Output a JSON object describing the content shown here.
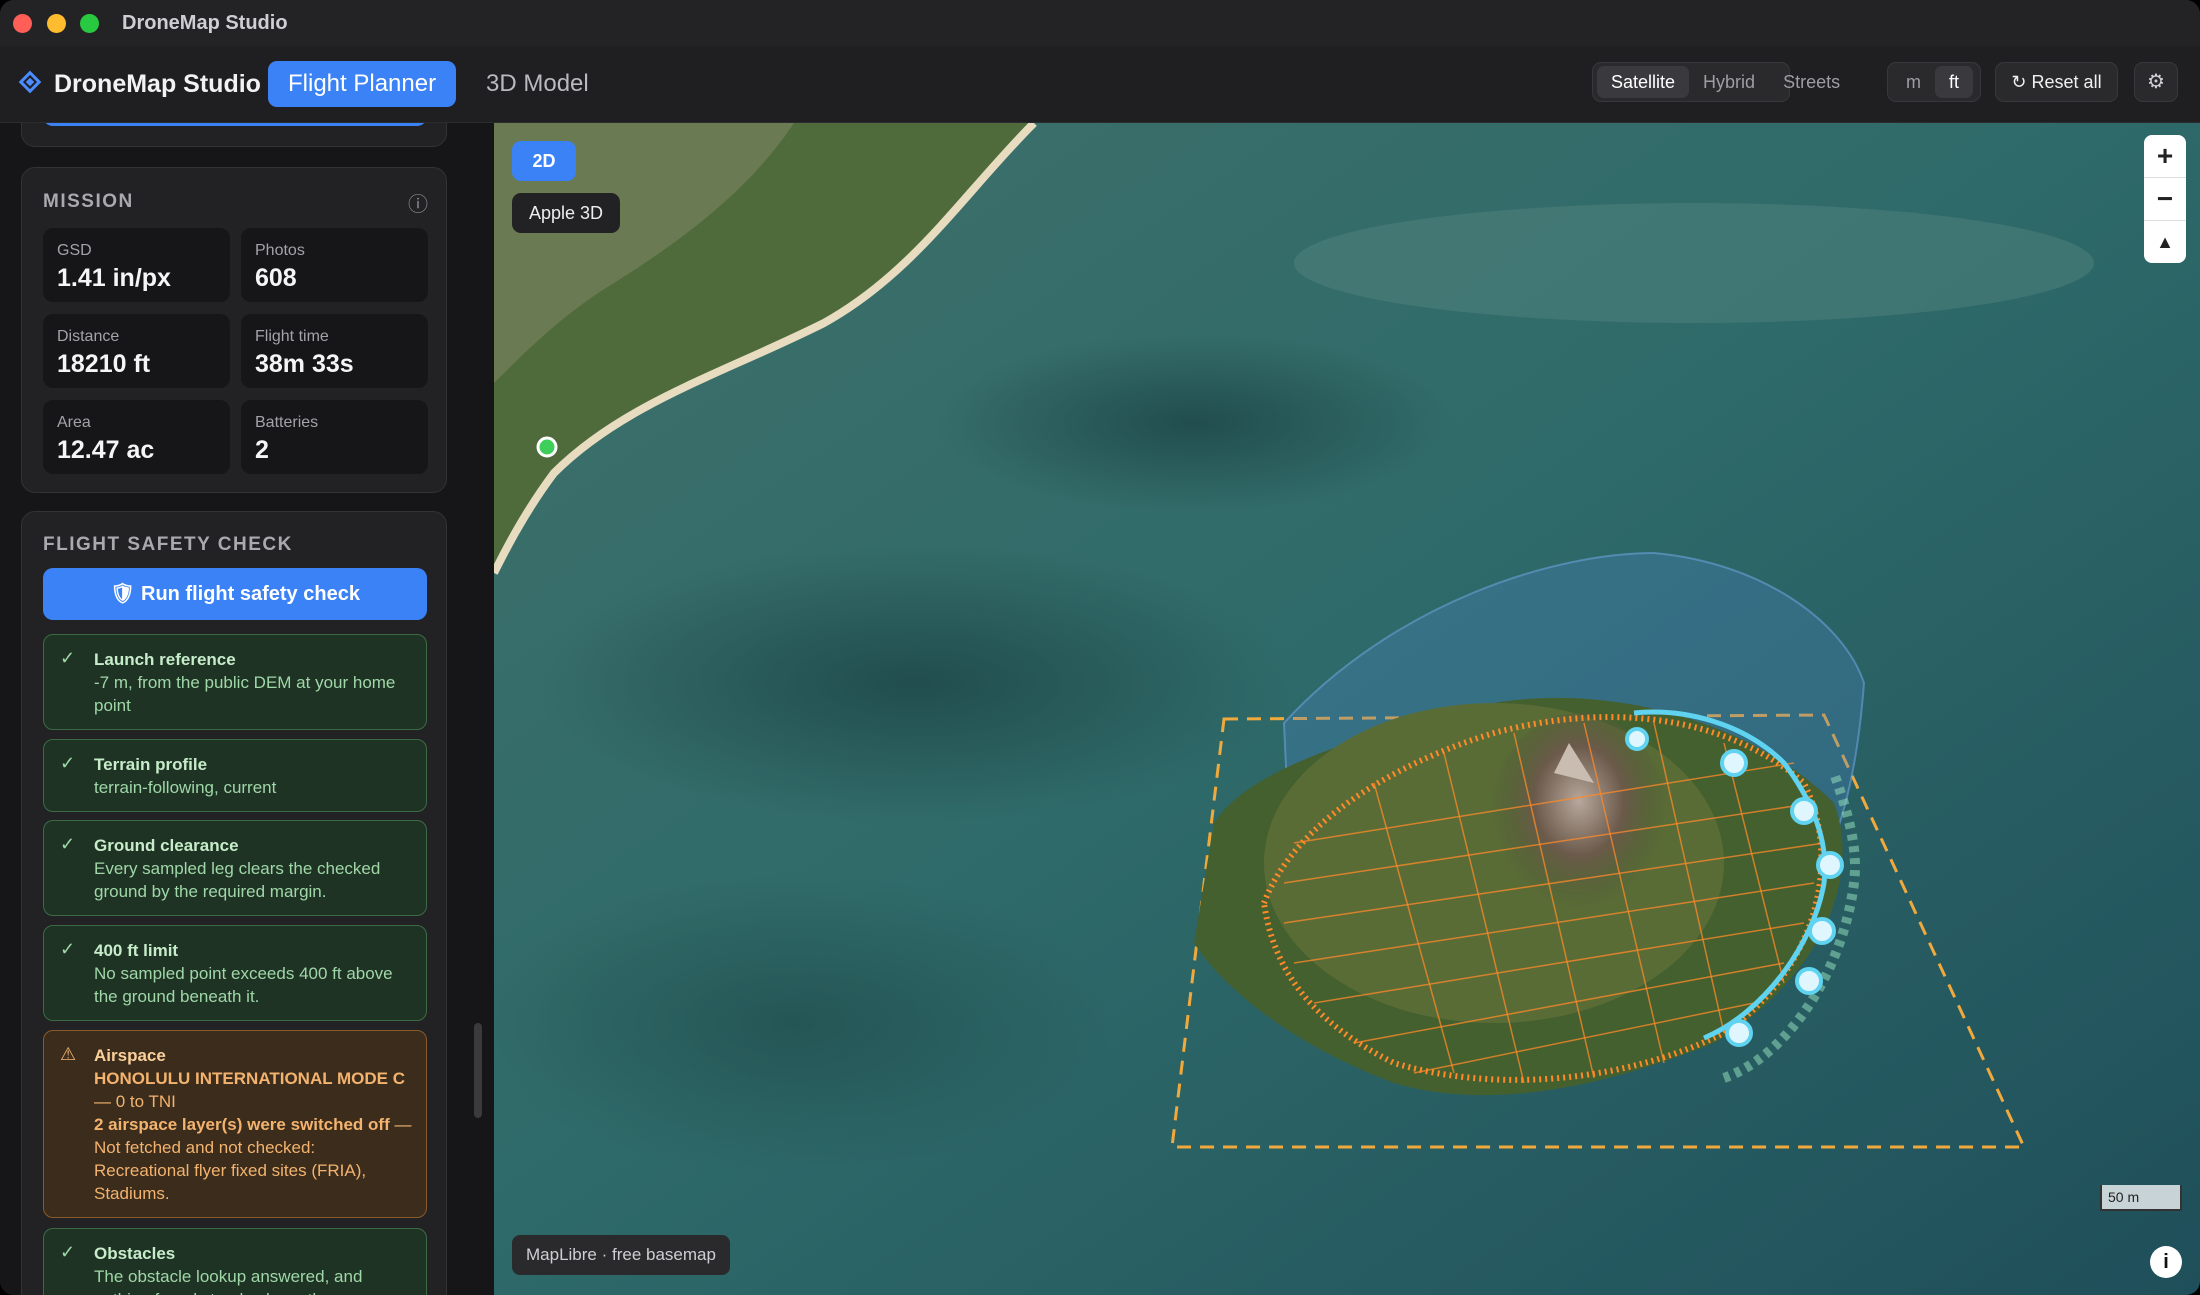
{
  "window": {
    "title": "DroneMap Studio"
  },
  "header": {
    "app_name": "DroneMap Studio",
    "tabs": [
      {
        "label": "Flight Planner"
      },
      {
        "label": "3D Model"
      }
    ],
    "basemap": [
      {
        "label": "Satellite"
      },
      {
        "label": "Hybrid"
      },
      {
        "label": "Streets"
      }
    ],
    "units": [
      {
        "label": "m"
      },
      {
        "label": "ft"
      }
    ],
    "reset_label": "Reset all",
    "reset_icon": "↻",
    "settings_icon": "⚙"
  },
  "mission": {
    "title": "MISSION",
    "info_icon": "ⓘ",
    "stats": [
      {
        "label": "GSD",
        "value": "1.41 in/px"
      },
      {
        "label": "Photos",
        "value": "608"
      },
      {
        "label": "Distance",
        "value": "18210 ft"
      },
      {
        "label": "Flight time",
        "value": "38m 33s"
      },
      {
        "label": "Area",
        "value": "12.47 ac"
      },
      {
        "label": "Batteries",
        "value": "2"
      }
    ]
  },
  "safety": {
    "title": "FLIGHT SAFETY CHECK",
    "run_label": "Run flight safety check",
    "run_icon": "🛡",
    "checks": [
      {
        "status": "ok",
        "icon": "✓",
        "title": "Launch reference",
        "text": "-7 m, from the public DEM at your home point"
      },
      {
        "status": "ok",
        "icon": "✓",
        "title": "Terrain profile",
        "text": "terrain-following, current"
      },
      {
        "status": "ok",
        "icon": "✓",
        "title": "Ground clearance",
        "text": "Every sampled leg clears the checked ground by the required margin."
      },
      {
        "status": "ok",
        "icon": "✓",
        "title": "400 ft limit",
        "text": "No sampled point exceeds 400 ft above the ground beneath it."
      },
      {
        "status": "warn",
        "icon": "⚠",
        "title": "Airspace",
        "line1_bold": "HONOLULU INTERNATIONAL MODE C",
        "line1_rest": " — 0 to TNI",
        "line2_bold": "2 airspace layer(s) were switched off",
        "line2_rest": " — Not fetched and not checked: Recreational flyer fixed sites (FRIA), Stadiums."
      },
      {
        "status": "ok",
        "icon": "✓",
        "title": "Obstacles",
        "text": "The obstacle lookup answered, and nothing found stands above the"
      }
    ]
  },
  "map": {
    "view_2d": "2D",
    "view_apple": "Apple 3D",
    "zoom_in": "+",
    "zoom_out": "−",
    "compass": "▲",
    "attribution": "MapLibre · free basemap",
    "scale": "50 m",
    "info": "i"
  },
  "colors": {
    "accent": "#3b82f6",
    "flight_path": "#ff8a2a",
    "waypoint": "#5fd3f0",
    "ok": "#3a6b45",
    "warn": "#8a5a2c"
  }
}
